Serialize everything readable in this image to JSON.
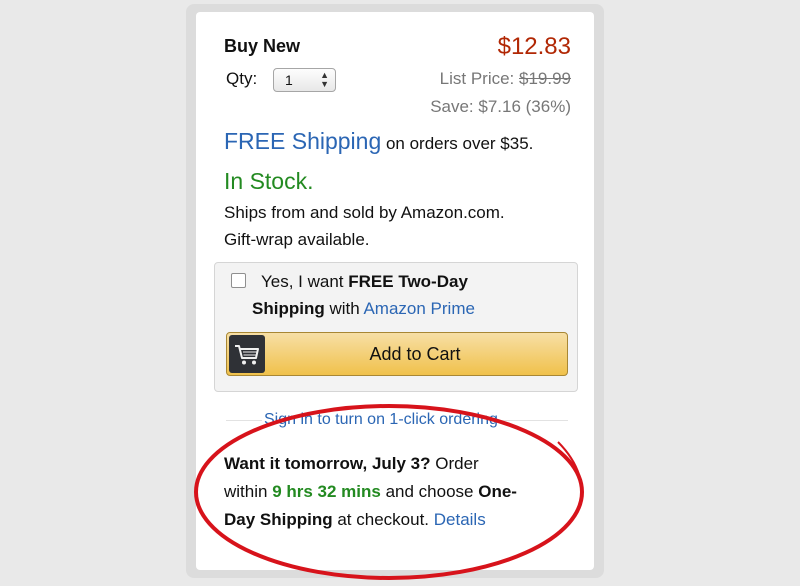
{
  "buy_box": {
    "heading": "Buy New",
    "price": "$12.83",
    "qty_label": "Qty:",
    "qty_value": "1",
    "list_price_label": "List Price: ",
    "list_price_value": "$19.99",
    "save_text": "Save: $7.16 (36%)"
  },
  "shipping": {
    "free_link": "FREE Shipping",
    "free_rest": " on orders over $35."
  },
  "stock": {
    "status": "In Stock.",
    "ships_from": "Ships from and sold by Amazon.com.",
    "gift_wrap": "Gift-wrap available."
  },
  "prime": {
    "line1_prefix": "Yes, I want ",
    "line1_bold": "FREE Two-Day",
    "line2_bold": "Shipping",
    "line2_mid": " with ",
    "line2_link": "Amazon Prime"
  },
  "cart": {
    "button_label": "Add to Cart",
    "icon": "cart-icon"
  },
  "signin_link": "Sign in to turn on 1-click ordering",
  "delivery": {
    "l1_bold": "Want it tomorrow, July 3?",
    "l1_rest": " Order",
    "l2_prefix": "within ",
    "l2_time": "9 hrs 32 mins",
    "l2_mid": " and choose ",
    "l2_bold": "One-",
    "l3_bold": "Day Shipping",
    "l3_rest": " at checkout. ",
    "l3_link": "Details"
  },
  "colors": {
    "price": "#b12704",
    "link": "#2b66b4",
    "in_stock": "#238a21",
    "button": "#f0c14b",
    "annotation": "#d7131b"
  }
}
